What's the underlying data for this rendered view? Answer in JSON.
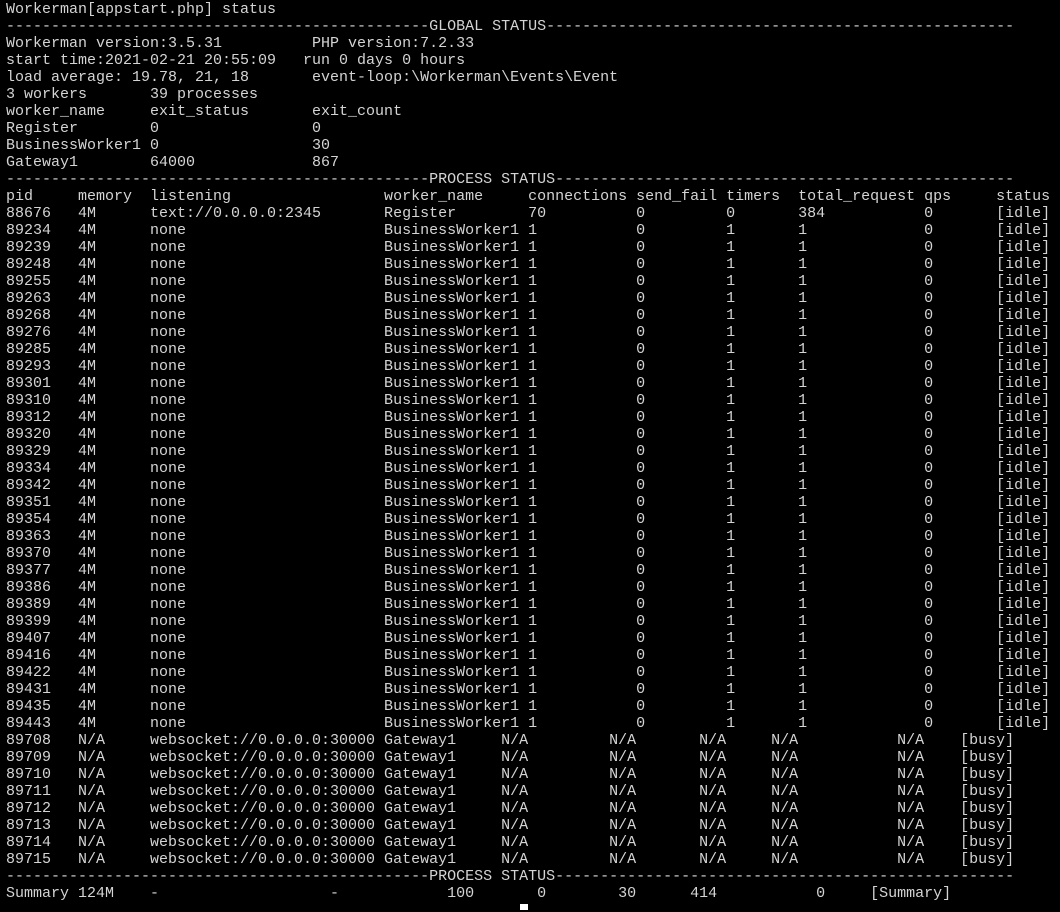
{
  "terminal": {
    "lines": [
      "Workerman[appstart.php] status",
      "-----------------------------------------------GLOBAL STATUS----------------------------------------------------",
      "Workerman version:3.5.31          PHP version:7.2.33",
      "start time:2021-02-21 20:55:09   run 0 days 0 hours",
      "load average: 19.78, 21, 18       event-loop:\\Workerman\\Events\\Event",
      "3 workers       39 processes",
      "worker_name     exit_status       exit_count",
      "Register        0                 0",
      "BusinessWorker1 0                 30",
      "Gateway1        64000             867",
      "-----------------------------------------------PROCESS STATUS---------------------------------------------------",
      "pid     memory  listening                 worker_name     connections send_fail timers  total_request qps     status",
      "88676   4M      text://0.0.0.0:2345       Register        70          0         0       384           0       [idle]",
      "89234   4M      none                      BusinessWorker1 1           0         1       1             0       [idle]",
      "89239   4M      none                      BusinessWorker1 1           0         1       1             0       [idle]",
      "89248   4M      none                      BusinessWorker1 1           0         1       1             0       [idle]",
      "89255   4M      none                      BusinessWorker1 1           0         1       1             0       [idle]",
      "89263   4M      none                      BusinessWorker1 1           0         1       1             0       [idle]",
      "89268   4M      none                      BusinessWorker1 1           0         1       1             0       [idle]",
      "89276   4M      none                      BusinessWorker1 1           0         1       1             0       [idle]",
      "89285   4M      none                      BusinessWorker1 1           0         1       1             0       [idle]",
      "89293   4M      none                      BusinessWorker1 1           0         1       1             0       [idle]",
      "89301   4M      none                      BusinessWorker1 1           0         1       1             0       [idle]",
      "89310   4M      none                      BusinessWorker1 1           0         1       1             0       [idle]",
      "89312   4M      none                      BusinessWorker1 1           0         1       1             0       [idle]",
      "89320   4M      none                      BusinessWorker1 1           0         1       1             0       [idle]",
      "89329   4M      none                      BusinessWorker1 1           0         1       1             0       [idle]",
      "89334   4M      none                      BusinessWorker1 1           0         1       1             0       [idle]",
      "89342   4M      none                      BusinessWorker1 1           0         1       1             0       [idle]",
      "89351   4M      none                      BusinessWorker1 1           0         1       1             0       [idle]",
      "89354   4M      none                      BusinessWorker1 1           0         1       1             0       [idle]",
      "89363   4M      none                      BusinessWorker1 1           0         1       1             0       [idle]",
      "89370   4M      none                      BusinessWorker1 1           0         1       1             0       [idle]",
      "89377   4M      none                      BusinessWorker1 1           0         1       1             0       [idle]",
      "89386   4M      none                      BusinessWorker1 1           0         1       1             0       [idle]",
      "89389   4M      none                      BusinessWorker1 1           0         1       1             0       [idle]",
      "89399   4M      none                      BusinessWorker1 1           0         1       1             0       [idle]",
      "89407   4M      none                      BusinessWorker1 1           0         1       1             0       [idle]",
      "89416   4M      none                      BusinessWorker1 1           0         1       1             0       [idle]",
      "89422   4M      none                      BusinessWorker1 1           0         1       1             0       [idle]",
      "89431   4M      none                      BusinessWorker1 1           0         1       1             0       [idle]",
      "89435   4M      none                      BusinessWorker1 1           0         1       1             0       [idle]",
      "89443   4M      none                      BusinessWorker1 1           0         1       1             0       [idle]",
      "89708   N/A     websocket://0.0.0.0:30000 Gateway1     N/A         N/A       N/A     N/A           N/A    [busy]",
      "89709   N/A     websocket://0.0.0.0:30000 Gateway1     N/A         N/A       N/A     N/A           N/A    [busy]",
      "89710   N/A     websocket://0.0.0.0:30000 Gateway1     N/A         N/A       N/A     N/A           N/A    [busy]",
      "89711   N/A     websocket://0.0.0.0:30000 Gateway1     N/A         N/A       N/A     N/A           N/A    [busy]",
      "89712   N/A     websocket://0.0.0.0:30000 Gateway1     N/A         N/A       N/A     N/A           N/A    [busy]",
      "89713   N/A     websocket://0.0.0.0:30000 Gateway1     N/A         N/A       N/A     N/A           N/A    [busy]",
      "89714   N/A     websocket://0.0.0.0:30000 Gateway1     N/A         N/A       N/A     N/A           N/A    [busy]",
      "89715   N/A     websocket://0.0.0.0:30000 Gateway1     N/A         N/A       N/A     N/A           N/A    [busy]",
      "-----------------------------------------------PROCESS STATUS---------------------------------------------------",
      "Summary 124M    -                   -            100       0        30      414           0     [Summary]"
    ],
    "colors": {
      "background": "#000000",
      "text": "#d4d4d4",
      "cursor": "#ffffff"
    }
  }
}
